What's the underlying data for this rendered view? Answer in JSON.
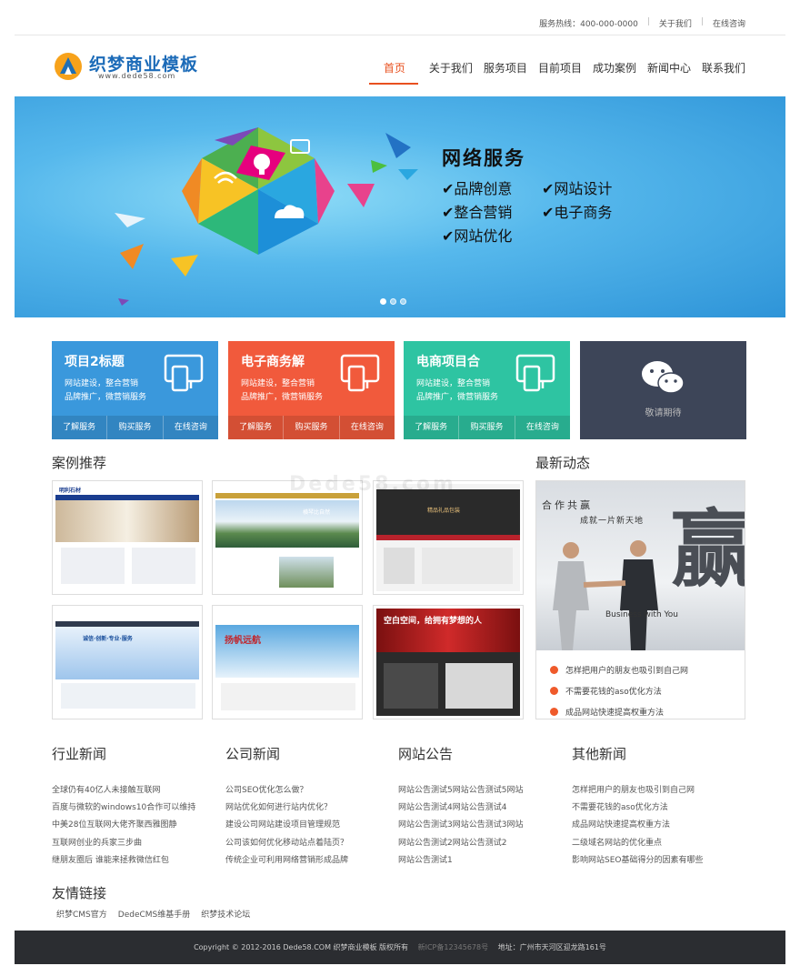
{
  "topbar": {
    "hotline": "服务热线：400-000-0000",
    "about": "关于我们",
    "consult": "在线咨询"
  },
  "header": {
    "logo_name": "织梦商业模板",
    "logo_url": "www.dede58.com",
    "nav": [
      "首页",
      "关于我们",
      "服务项目",
      "目前项目",
      "成功案例",
      "新闻中心",
      "联系我们"
    ],
    "active_nav": "首页"
  },
  "banner": {
    "title": "网络服务",
    "features": [
      "✔品牌创意",
      "✔网站设计",
      "✔整合营销",
      "✔电子商务",
      "✔网站优化"
    ],
    "dots": 3,
    "active_dot": 0
  },
  "services": [
    {
      "title": "项目2标题",
      "desc1": "网站建设，整合营销",
      "desc2": "品牌推广，微营销服务",
      "color": "#3a98dc",
      "actions": [
        "了解服务",
        "购买服务",
        "在线咨询"
      ]
    },
    {
      "title": "电子商务解",
      "desc1": "网站建设，整合营销",
      "desc2": "品牌推广，微营销服务",
      "color": "#f15a3c",
      "actions": [
        "了解服务",
        "购买服务",
        "在线咨询"
      ]
    },
    {
      "title": "电商项目合",
      "desc1": "网站建设，整合营销",
      "desc2": "品牌推广，微营销服务",
      "color": "#2ec4a2",
      "actions": [
        "了解服务",
        "购买服务",
        "在线咨询"
      ]
    },
    {
      "title": "",
      "wait": "敬请期待",
      "color": "#3d4558"
    }
  ],
  "cases": {
    "title": "案例推荐",
    "watermark": "Dede58.com",
    "items": [
      {
        "label": "明利石材"
      },
      {
        "label": "横琴比自然"
      },
      {
        "label": "精品礼品包装"
      },
      {
        "label": "诚信·创新·专业·服务"
      },
      {
        "label": "扬帆远航"
      },
      {
        "label": "空白空间，给拥有梦想的人"
      }
    ]
  },
  "latest": {
    "title": "最新动态",
    "slogan1": "合作共赢",
    "slogan2": "成就一片新天地",
    "bigchar": "赢",
    "business": "Business with You",
    "items": [
      "怎样把用户的朋友也吸引到自己网",
      "不需要花钱的aso优化方法",
      "成品网站快速提高权重方法"
    ]
  },
  "news_columns": [
    {
      "title": "行业新闻",
      "items": [
        "全球仍有40亿人未接触互联网",
        "百度与微软的windows10合作可以维持",
        "中美28位互联网大佬齐聚西雅图静",
        "互联网创业的兵家三步曲",
        "继朋友圈后 谁能来拯救微信红包"
      ]
    },
    {
      "title": "公司新闻",
      "items": [
        "公司SEO优化怎么做？",
        "网站优化如何进行站内优化？",
        "建设公司网站建设项目管理规范",
        "公司该如何优化移动站点着陆页？",
        "传统企业可利用网络营销形成品牌"
      ]
    },
    {
      "title": "网站公告",
      "items": [
        "网站公告测试5网站公告测试5网站",
        "网站公告测试4网站公告测试4",
        "网站公告测试3网站公告测试3网站",
        "网站公告测试2网站公告测试2",
        "网站公告测试1"
      ]
    },
    {
      "title": "其他新闻",
      "items": [
        "怎样把用户的朋友也吸引到自己网",
        "不需要花钱的aso优化方法",
        "成品网站快速提高权重方法",
        "二级域名网站的优化重点",
        "影响网站SEO基础得分的因素有哪些"
      ]
    }
  ],
  "friends": {
    "title": "友情链接",
    "links": [
      "织梦CMS官方",
      "DedeCMS维基手册",
      "织梦技术论坛"
    ]
  },
  "footer": {
    "copyright": "Copyright © 2012-2016 Dede58.COM 织梦商业模板 版权所有",
    "icp": "新ICP备12345678号",
    "address": "地址：广州市天河区迎龙路161号"
  }
}
